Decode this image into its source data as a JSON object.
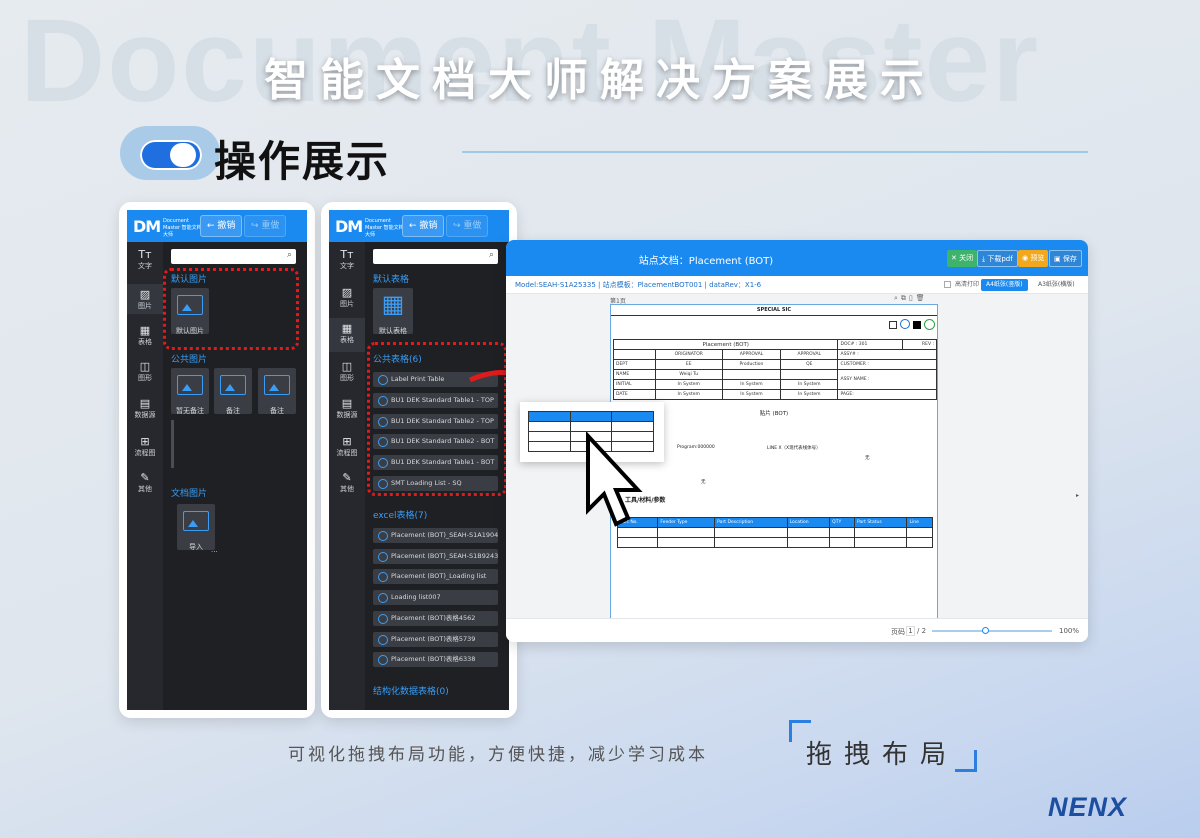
{
  "watermark": "Document Master",
  "page_title": "智能文档大师解决方案展示",
  "section": {
    "title": "操作展示"
  },
  "app": {
    "logo": "DM",
    "logo_sub": "Document Master 智能文档大师",
    "undo": "← 撤销",
    "redo": "↪ 重做",
    "sidebar": [
      "文字",
      "图片",
      "表格",
      "图形",
      "数据源",
      "流程图",
      "其他"
    ],
    "sidebar_icons": [
      "text-icon",
      "image-icon",
      "table-icon",
      "shape-icon",
      "datasource-icon",
      "flowchart-icon",
      "tools-icon"
    ]
  },
  "panel1": {
    "group_default": "默认图片",
    "default_item": "默认图片",
    "group_public": "公共图片",
    "public_items": [
      "暂无备注",
      "备注",
      "备注"
    ],
    "group_doc": "文档图片",
    "doc_item": "导入",
    "ellipsis": "..."
  },
  "panel2": {
    "group_default": "默认表格",
    "default_item": "默认表格",
    "group_public": "公共表格(6)",
    "public_items": [
      "Label Print Table",
      "BU1 DEK Standard Table1 - TOP",
      "BU1 DEK Standard Table2 - TOP",
      "BU1 DEK Standard Table2 - BOT",
      "BU1 DEK Standard Table1 - BOT",
      "SMT Loading List - SQ"
    ],
    "group_excel": "excel表格(7)",
    "excel_items": [
      "Placement (BOT)_SEAH-S1A1904...",
      "Placement (BOT)_SEAH-S1B9243...",
      "Placement (BOT)_Loading list",
      "Loading list007",
      "Placement (BOT)表格4562",
      "Placement (BOT)表格5739",
      "Placement (BOT)表格6338"
    ],
    "group_struct": "结构化数据表格(0)"
  },
  "editor": {
    "title": "站点文档：Placement (BOT)",
    "btn_close": "✕ 关闭",
    "btn_download": "⤓ 下载pdf",
    "btn_preview": "◉ 预览",
    "btn_save": "▣ 保存",
    "info": "Model:SEAH-S1A25335  |  站点模板：PlacementBOT001  |  dataRev：X1-6",
    "print_check": "高清打印",
    "paper_a4": "A4纸张(竖版)",
    "paper_a3": "A3纸张(横版)",
    "page_label": "第1页",
    "doc": {
      "special": "SPECIAL SIC",
      "title": "Placement (BOT)",
      "doc_no": "DOC# : 301",
      "rev": "REV :",
      "headers": [
        "ORIGINATOR",
        "APPROVAL",
        "APPROVAL"
      ],
      "dept_row": [
        "DEPT",
        "EE",
        "Production",
        "QE"
      ],
      "name_row": [
        "NAME",
        "Weiqi Tu",
        "",
        ""
      ],
      "initial_row": [
        "INITIAL",
        "In System",
        "In System",
        "In System"
      ],
      "date_row": [
        "DATE",
        "In System",
        "In System",
        "In System"
      ],
      "right_labels": [
        "ASSY# :",
        "CUSTOMER :",
        "ASSY NAME :",
        "PAGE:"
      ],
      "bot": "贴片 (BOT)",
      "program": "Program:000000",
      "line": "LINE X（X现代表线体号）",
      "side_note": "无",
      "side_note2": "无",
      "section": "工具/材料/参数",
      "cols": [
        "Part No.",
        "Feeder Type",
        "Part Description",
        "Location",
        "QTY",
        "Part Status",
        "Line"
      ]
    },
    "footer_page_label": "页码",
    "footer_page": "1",
    "footer_total": "/ 2",
    "zoom": "100%"
  },
  "bottom": {
    "text": "可视化拖拽布局功能，方便快捷，减少学习成本",
    "label": "拖拽布局",
    "brand": "NENX"
  },
  "colors": {
    "accent": "#1b8af0",
    "highlight": "#e11b1b"
  }
}
